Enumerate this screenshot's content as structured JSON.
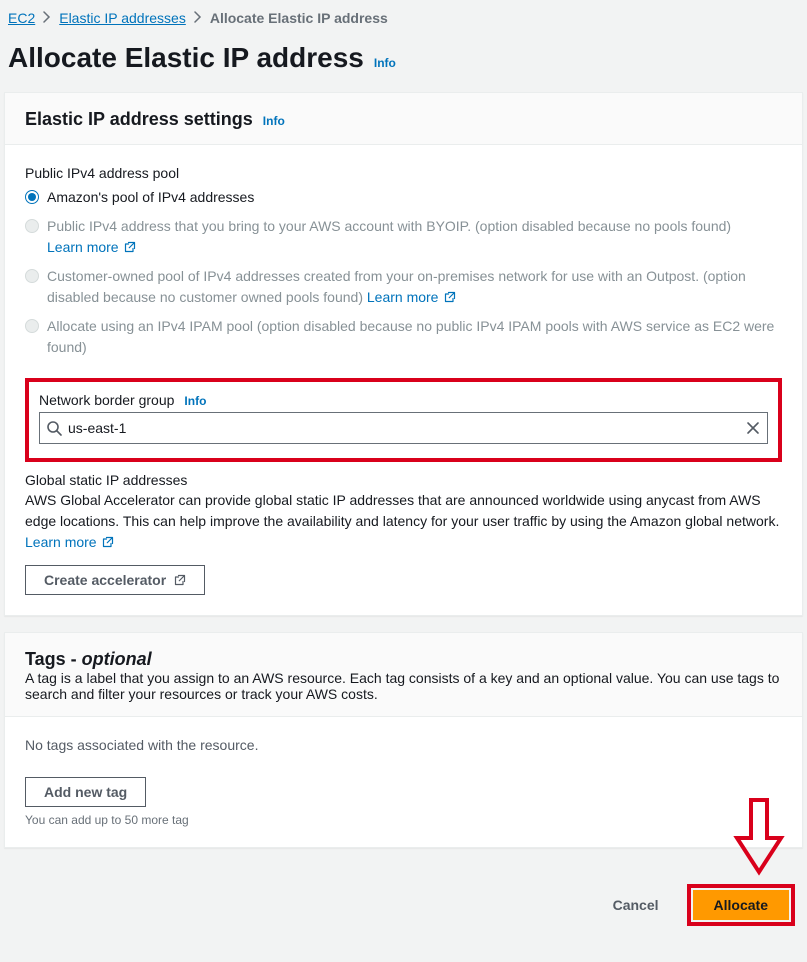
{
  "breadcrumb": {
    "items": [
      "EC2",
      "Elastic IP addresses"
    ],
    "current": "Allocate Elastic IP address"
  },
  "page": {
    "title": "Allocate Elastic IP address",
    "info": "Info"
  },
  "settings": {
    "header": "Elastic IP address settings",
    "info": "Info",
    "pool_label": "Public IPv4 address pool",
    "options": [
      {
        "label": "Amazon's pool of IPv4 addresses",
        "selected": true,
        "disabled": false
      },
      {
        "label": "Public IPv4 address that you bring to your AWS account with BYOIP. (option disabled because no pools found) ",
        "selected": false,
        "disabled": true,
        "learn_more": "Learn more"
      },
      {
        "label": "Customer-owned pool of IPv4 addresses created from your on-premises network for use with an Outpost. (option disabled because no customer owned pools found) ",
        "selected": false,
        "disabled": true,
        "learn_more": "Learn more"
      },
      {
        "label": "Allocate using an IPv4 IPAM pool (option disabled because no public IPv4 IPAM pools with AWS service as EC2 were found)",
        "selected": false,
        "disabled": true
      }
    ],
    "border_group": {
      "label": "Network border group",
      "info": "Info",
      "value": "us-east-1"
    },
    "global_static": {
      "heading": "Global static IP addresses",
      "desc": "AWS Global Accelerator can provide global static IP addresses that are announced worldwide using anycast from AWS edge locations. This can help improve the availability and latency for your user traffic by using the Amazon global network. ",
      "learn_more": "Learn more",
      "button": "Create accelerator"
    }
  },
  "tags": {
    "header": "Tags - ",
    "optional": "optional",
    "desc": "A tag is a label that you assign to an AWS resource. Each tag consists of a key and an optional value. You can use tags to search and filter your resources or track your AWS costs.",
    "empty": "No tags associated with the resource.",
    "add_button": "Add new tag",
    "hint": "You can add up to 50 more tag"
  },
  "footer": {
    "cancel": "Cancel",
    "allocate": "Allocate"
  }
}
